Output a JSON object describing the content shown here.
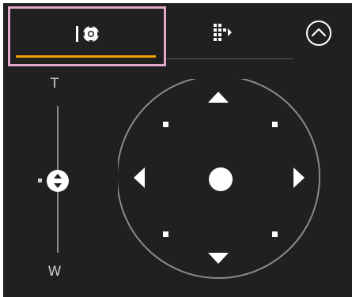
{
  "tabs": [
    {
      "id": "pan-tilt",
      "icon": "pan-tilt-icon",
      "active": true
    },
    {
      "id": "preset",
      "icon": "grid-arrow-icon",
      "active": false
    }
  ],
  "collapse": {
    "icon": "chevron-up-circle-icon"
  },
  "zoom": {
    "tele_label": "T",
    "wide_label": "W"
  },
  "joystick": {
    "up": "triangle-up-icon",
    "down": "triangle-down-icon",
    "left": "triangle-left-icon",
    "right": "triangle-right-icon",
    "center": "center-dot-icon",
    "diagonals": [
      "up-left",
      "up-right",
      "down-left",
      "down-right"
    ]
  },
  "colors": {
    "background": "#202020",
    "accent": "#f0a000",
    "highlight_border": "#e2a8c8",
    "foreground": "#ffffff"
  }
}
